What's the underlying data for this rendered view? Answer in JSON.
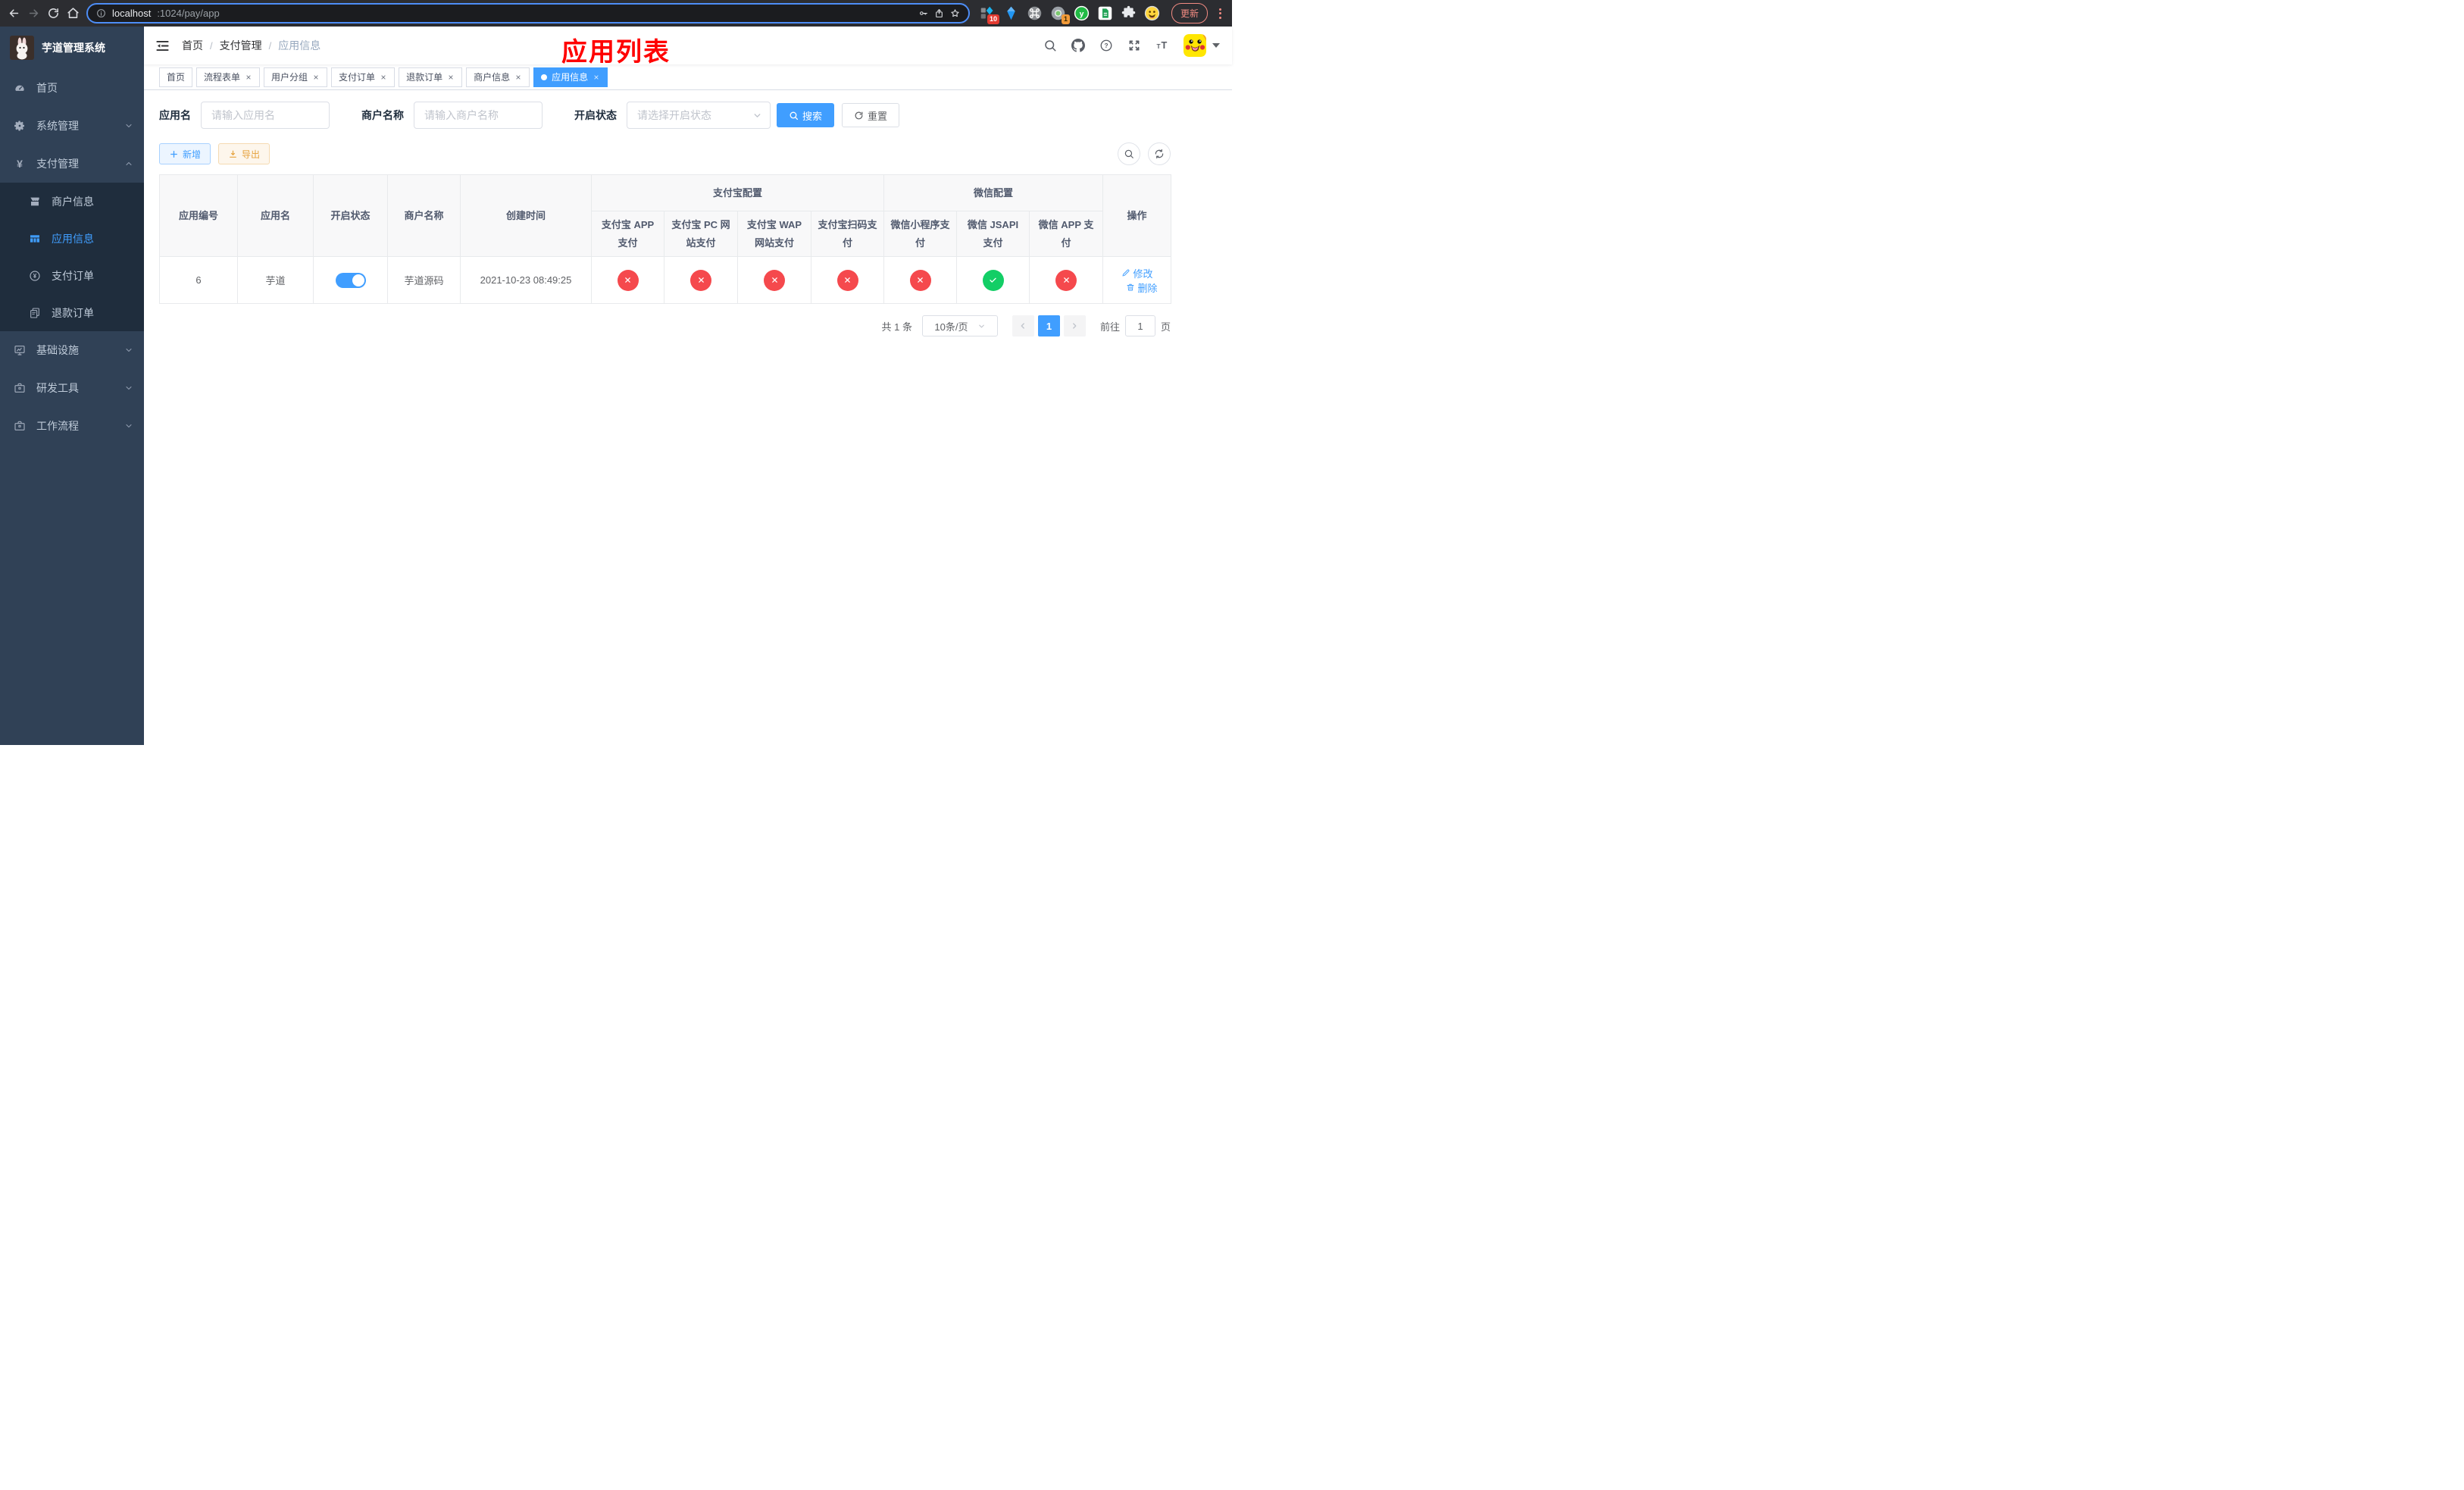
{
  "colors": {
    "accent": "#409eff",
    "danger": "#f5494d",
    "success": "#13ce66",
    "warning": "#e6a23c",
    "sidebar_bg": "#304156",
    "submenu_bg": "#1f2d3d"
  },
  "browser": {
    "url": {
      "host": "localhost",
      "rest": ":1024/pay/app"
    },
    "update_label": "更新",
    "badges": {
      "ext1": "10",
      "ext2": "1"
    }
  },
  "sidebar": {
    "title": "芋道管理系统",
    "menu": [
      {
        "id": "home",
        "icon": "dashboard",
        "label": "首页",
        "level": 1
      },
      {
        "id": "system",
        "icon": "gear",
        "label": "系统管理",
        "level": 1,
        "chevron": "down"
      },
      {
        "id": "payment",
        "icon": "yen",
        "label": "支付管理",
        "level": 1,
        "chevron": "up"
      },
      {
        "id": "merchant-info",
        "icon": "shop",
        "label": "商户信息",
        "level": 2
      },
      {
        "id": "app-info",
        "icon": "grid",
        "label": "应用信息",
        "level": 2,
        "active": true
      },
      {
        "id": "pay-order",
        "icon": "yencircle",
        "label": "支付订单",
        "level": 2
      },
      {
        "id": "refund-order",
        "icon": "docs",
        "label": "退款订单",
        "level": 2
      },
      {
        "id": "infrastructure",
        "icon": "monitor",
        "label": "基础设施",
        "level": 1,
        "chevron": "down"
      },
      {
        "id": "dev-tools",
        "icon": "briefcase",
        "label": "研发工具",
        "level": 1,
        "chevron": "down"
      },
      {
        "id": "workflow",
        "icon": "briefcase",
        "label": "工作流程",
        "level": 1,
        "chevron": "down"
      }
    ]
  },
  "header": {
    "breadcrumb": [
      "首页",
      "支付管理",
      "应用信息"
    ]
  },
  "annotation": {
    "title": "应用列表"
  },
  "tabs": [
    {
      "label": "首页",
      "closable": false,
      "active": false
    },
    {
      "label": "流程表单",
      "closable": true,
      "active": false
    },
    {
      "label": "用户分组",
      "closable": true,
      "active": false
    },
    {
      "label": "支付订单",
      "closable": true,
      "active": false
    },
    {
      "label": "退款订单",
      "closable": true,
      "active": false
    },
    {
      "label": "商户信息",
      "closable": true,
      "active": false
    },
    {
      "label": "应用信息",
      "closable": true,
      "active": true
    }
  ],
  "filters": {
    "fields": [
      {
        "label": "应用名",
        "placeholder": "请输入应用名",
        "type": "input"
      },
      {
        "label": "商户名称",
        "placeholder": "请输入商户名称",
        "type": "input"
      },
      {
        "label": "开启状态",
        "placeholder": "请选择开启状态",
        "type": "select"
      }
    ],
    "search_label": "搜索",
    "reset_label": "重置"
  },
  "toolbar": {
    "add_label": "新增",
    "export_label": "导出"
  },
  "table": {
    "plain_columns": [
      "应用编号",
      "应用名",
      "开启状态",
      "商户名称",
      "创建时间"
    ],
    "groups": [
      {
        "label": "支付宝配置",
        "children": [
          "支付宝 APP 支付",
          "支付宝 PC 网站支付",
          "支付宝 WAP 网站支付",
          "支付宝扫码支付"
        ]
      },
      {
        "label": "微信配置",
        "children": [
          "微信小程序支付",
          "微信 JSAPI 支付",
          "微信 APP 支付"
        ]
      }
    ],
    "action_column": "操作",
    "rows": [
      {
        "id": "6",
        "name": "芋道",
        "enabled": true,
        "merchant": "芋道源码",
        "created_at": "2021-10-23 08:49:25",
        "channels": [
          false,
          false,
          false,
          false,
          false,
          true,
          false
        ],
        "edit_label": "修改",
        "delete_label": "删除"
      }
    ]
  },
  "pagination": {
    "total": "共 1 条",
    "page_size": "10条/页",
    "current": "1",
    "goto_label": "前往",
    "goto_value": "1",
    "goto_suffix": "页"
  }
}
